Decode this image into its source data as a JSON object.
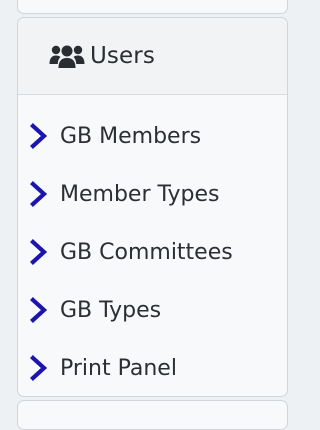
{
  "panel": {
    "title": "Users",
    "icon": "users-icon"
  },
  "menu": {
    "item_icon": "chevron-right-icon",
    "chevron_color": "#1c14b0",
    "items": [
      {
        "label": "GB Members"
      },
      {
        "label": "Member Types"
      },
      {
        "label": "GB Committees"
      },
      {
        "label": "GB Types"
      },
      {
        "label": "Print Panel"
      }
    ]
  }
}
